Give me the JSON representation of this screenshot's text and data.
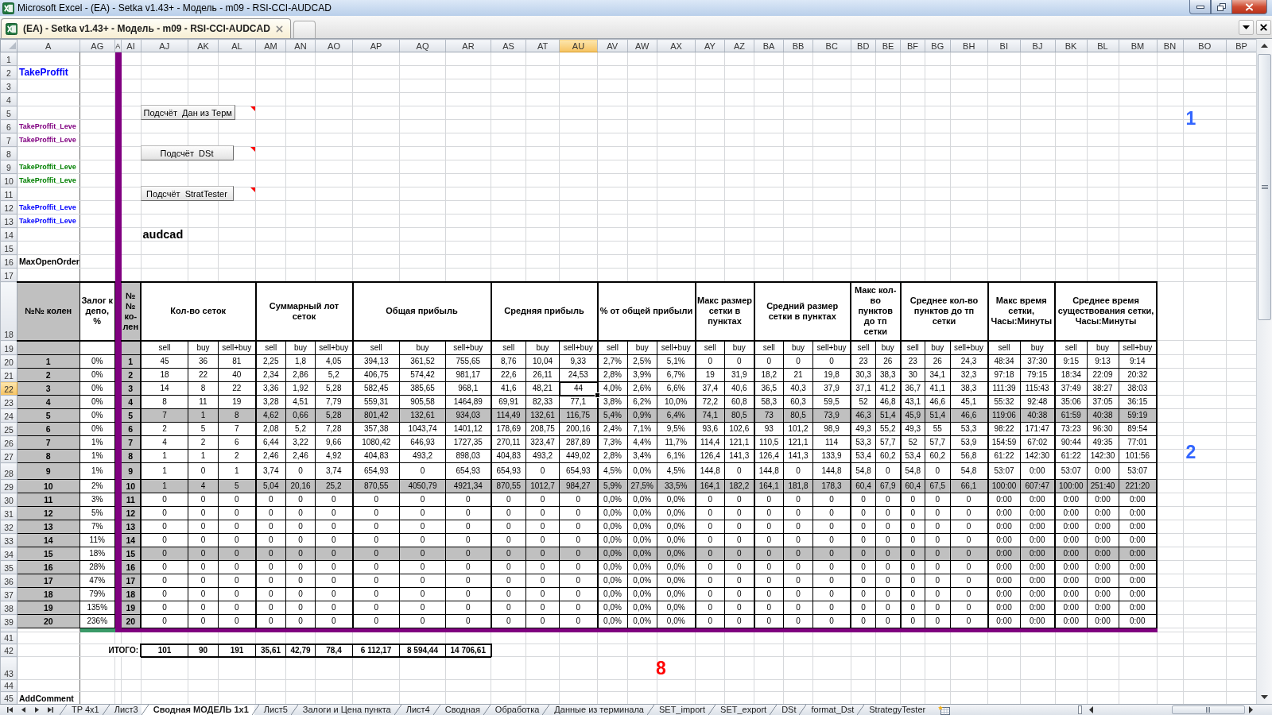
{
  "window": {
    "title": "Microsoft Excel - (EA) - Setka v1.43+ - Модель - m09 - RSI-CCI-AUDCAD"
  },
  "document_tabs": [
    {
      "label": "(EA) - Setka v1.43+ - Модель - m09 - RSI-CCI-AUDCAD",
      "selected": true
    }
  ],
  "columns": [
    {
      "label": "A",
      "selected": false
    },
    {
      "label": "AG",
      "selected": false
    },
    {
      "label": "A",
      "selected": false
    },
    {
      "label": "AI",
      "selected": false
    },
    {
      "label": "AJ",
      "selected": false
    },
    {
      "label": "AK",
      "selected": false
    },
    {
      "label": "AL",
      "selected": false
    },
    {
      "label": "AM",
      "selected": false
    },
    {
      "label": "AN",
      "selected": false
    },
    {
      "label": "AO",
      "selected": false
    },
    {
      "label": "AP",
      "selected": false
    },
    {
      "label": "AQ",
      "selected": false
    },
    {
      "label": "AR",
      "selected": false
    },
    {
      "label": "AS",
      "selected": false
    },
    {
      "label": "AT",
      "selected": false
    },
    {
      "label": "AU",
      "selected": true
    },
    {
      "label": "AV",
      "selected": false
    },
    {
      "label": "AW",
      "selected": false
    },
    {
      "label": "AX",
      "selected": false
    },
    {
      "label": "AY",
      "selected": false
    },
    {
      "label": "AZ",
      "selected": false
    },
    {
      "label": "BA",
      "selected": false
    },
    {
      "label": "BB",
      "selected": false
    },
    {
      "label": "BC",
      "selected": false
    },
    {
      "label": "BD",
      "selected": false
    },
    {
      "label": "BE",
      "selected": false
    },
    {
      "label": "BF",
      "selected": false
    },
    {
      "label": "BG",
      "selected": false
    },
    {
      "label": "BH",
      "selected": false
    },
    {
      "label": "BI",
      "selected": false
    },
    {
      "label": "BJ",
      "selected": false
    },
    {
      "label": "BK",
      "selected": false
    },
    {
      "label": "BL",
      "selected": false
    },
    {
      "label": "BM",
      "selected": false
    },
    {
      "label": "BN",
      "selected": false
    },
    {
      "label": "BO",
      "selected": false
    },
    {
      "label": "BP",
      "selected": false
    }
  ],
  "rows_above": [
    {
      "number": "1",
      "selected": false
    },
    {
      "number": "2",
      "selected": false,
      "label": {
        "text": "TakeProffit",
        "kind": "title",
        "color": "#0000ff"
      }
    },
    {
      "number": "3",
      "selected": false
    },
    {
      "number": "4",
      "selected": false
    },
    {
      "number": "5",
      "selected": false,
      "button": {
        "label": "Подсчёт  Дан из Терм",
        "comment_marker": true
      },
      "marker": {
        "text": "1",
        "color": "#3366ff"
      }
    },
    {
      "number": "6",
      "selected": false,
      "label": {
        "text": "TakeProffit_Leve",
        "kind": "level",
        "color": "#800080"
      }
    },
    {
      "number": "7",
      "selected": false,
      "label": {
        "text": "TakeProffit_Leve",
        "kind": "level",
        "color": "#800080"
      }
    },
    {
      "number": "8",
      "selected": false,
      "button": {
        "label": "Подсчёт  DSt",
        "comment_marker": true
      }
    },
    {
      "number": "9",
      "selected": false,
      "label": {
        "text": "TakeProffit_Leve",
        "kind": "level",
        "color": "#008000"
      }
    },
    {
      "number": "10",
      "selected": false,
      "label": {
        "text": "TakeProffit_Leve",
        "kind": "level",
        "color": "#008000"
      }
    },
    {
      "number": "11",
      "selected": false,
      "button": {
        "label": "Подсчёт  StratTester",
        "comment_marker": true
      }
    },
    {
      "number": "12",
      "selected": false,
      "label": {
        "text": "TakeProffit_Leve",
        "kind": "level",
        "color": "#0000ff"
      }
    },
    {
      "number": "13",
      "selected": false,
      "label": {
        "text": "TakeProffit_Leve",
        "kind": "level",
        "color": "#0000ff"
      }
    },
    {
      "number": "14",
      "selected": false,
      "symbol": "audcad"
    },
    {
      "number": "15",
      "selected": false
    },
    {
      "number": "16",
      "selected": false,
      "label": {
        "text": "MaxOpenOrder",
        "kind": "param",
        "color": "#000000"
      }
    },
    {
      "number": "17",
      "selected": false
    }
  ],
  "table": {
    "header_row": {
      "number": "18",
      "selected": false
    },
    "subheader_row": {
      "number": "19",
      "selected": false
    },
    "key_title": "№№ колен",
    "deposit_title": "Залог к депо, %",
    "index_title": "№ № ко-лен",
    "groups": [
      {
        "title": "Кол-во сеток",
        "columns": [
          "sell",
          "buy",
          "sell+buy"
        ]
      },
      {
        "title": "Суммарный лот сеток",
        "columns": [
          "sell",
          "buy",
          "sell+buy"
        ]
      },
      {
        "title": "Общая прибыль",
        "columns": [
          "sell",
          "buy",
          "sell+buy"
        ]
      },
      {
        "title": "Средняя прибыль",
        "columns": [
          "sell",
          "buy",
          "sell+buy"
        ]
      },
      {
        "title": "% от общей прибыли",
        "columns": [
          "sell",
          "buy",
          "sell+buy"
        ]
      },
      {
        "title": "Макс размер сетки в пунктах",
        "columns": [
          "sell",
          "buy"
        ]
      },
      {
        "title": "Средний размер сетки в пунктах",
        "columns": [
          "sell",
          "buy",
          "sell+buy"
        ]
      },
      {
        "title": "Макс кол-во пунктов до тп сетки",
        "columns": [
          "sell",
          "buy"
        ]
      },
      {
        "title": "Среднее кол-во пунктов до тп сетки",
        "columns": [
          "sell",
          "buy",
          "sell+buy"
        ]
      },
      {
        "title": "Макс время сетки, Часы:Минуты",
        "columns": [
          "sell",
          "buy"
        ]
      },
      {
        "title": "Среднее время существования сетки, Часы:Минуты",
        "columns": [
          "sell",
          "buy",
          "sell+buy"
        ]
      }
    ],
    "rows": [
      {
        "number": "20",
        "selected": false,
        "highlighted": false,
        "key": "1",
        "deposit": "0%",
        "index": "1",
        "values": [
          "45",
          "36",
          "81",
          "2,25",
          "1,8",
          "4,05",
          "394,13",
          "361,52",
          "755,65",
          "8,76",
          "10,04",
          "9,33",
          "2,7%",
          "2,5%",
          "5,1%",
          "0",
          "0",
          "0",
          "0",
          "0",
          "23",
          "26",
          "23",
          "26",
          "24,3",
          "48:34",
          "37:30",
          "9:15",
          "9:13",
          "9:14"
        ]
      },
      {
        "number": "21",
        "selected": false,
        "highlighted": false,
        "key": "2",
        "deposit": "0%",
        "index": "2",
        "values": [
          "18",
          "22",
          "40",
          "2,34",
          "2,86",
          "5,2",
          "406,75",
          "574,42",
          "981,17",
          "22,6",
          "26,11",
          "24,53",
          "2,8%",
          "3,9%",
          "6,7%",
          "19",
          "31,9",
          "18,2",
          "21",
          "19,8",
          "30,3",
          "38,3",
          "30",
          "34,1",
          "32,3",
          "97:18",
          "79:15",
          "18:34",
          "22:09",
          "20:32"
        ]
      },
      {
        "number": "22",
        "selected": true,
        "highlighted": false,
        "key": "3",
        "deposit": "0%",
        "index": "3",
        "values": [
          "14",
          "8",
          "22",
          "3,36",
          "1,92",
          "5,28",
          "582,45",
          "385,65",
          "968,1",
          "41,6",
          "48,21",
          "44",
          "4,0%",
          "2,6%",
          "6,6%",
          "37,4",
          "40,6",
          "36,5",
          "40,3",
          "37,9",
          "37,1",
          "41,2",
          "36,7",
          "41,1",
          "38,3",
          "111:39",
          "115:43",
          "37:49",
          "38:27",
          "38:03"
        ]
      },
      {
        "number": "23",
        "selected": false,
        "highlighted": false,
        "key": "4",
        "deposit": "0%",
        "index": "4",
        "values": [
          "8",
          "11",
          "19",
          "3,28",
          "4,51",
          "7,79",
          "559,31",
          "905,58",
          "1464,89",
          "69,91",
          "82,33",
          "77,1",
          "3,8%",
          "6,2%",
          "10,0%",
          "72,2",
          "60,8",
          "58,3",
          "60,3",
          "59,5",
          "52",
          "46,8",
          "43,1",
          "46,6",
          "45,1",
          "55:32",
          "92:48",
          "35:06",
          "37:05",
          "36:15"
        ]
      },
      {
        "number": "24",
        "selected": false,
        "highlighted": true,
        "key": "5",
        "deposit": "0%",
        "index": "5",
        "values": [
          "7",
          "1",
          "8",
          "4,62",
          "0,66",
          "5,28",
          "801,42",
          "132,61",
          "934,03",
          "114,49",
          "132,61",
          "116,75",
          "5,4%",
          "0,9%",
          "6,4%",
          "74,1",
          "80,5",
          "73",
          "80,5",
          "73,9",
          "46,3",
          "51,4",
          "45,9",
          "51,4",
          "46,6",
          "119:06",
          "40:38",
          "61:59",
          "40:38",
          "59:19"
        ]
      },
      {
        "number": "25",
        "selected": false,
        "highlighted": false,
        "key": "6",
        "deposit": "0%",
        "index": "6",
        "values": [
          "2",
          "5",
          "7",
          "2,08",
          "5,2",
          "7,28",
          "357,38",
          "1043,74",
          "1401,12",
          "178,69",
          "208,75",
          "200,16",
          "2,4%",
          "7,1%",
          "9,5%",
          "93,6",
          "102,6",
          "93",
          "101,2",
          "98,9",
          "49,3",
          "55,2",
          "49,3",
          "55",
          "53,3",
          "98:22",
          "171:47",
          "73:23",
          "96:30",
          "89:54"
        ]
      },
      {
        "number": "26",
        "selected": false,
        "highlighted": false,
        "key": "7",
        "deposit": "1%",
        "index": "7",
        "values": [
          "4",
          "2",
          "6",
          "6,44",
          "3,22",
          "9,66",
          "1080,42",
          "646,93",
          "1727,35",
          "270,11",
          "323,47",
          "287,89",
          "7,3%",
          "4,4%",
          "11,7%",
          "114,4",
          "121,1",
          "110,5",
          "121,1",
          "114",
          "53,3",
          "57,7",
          "52",
          "57,7",
          "53,9",
          "154:59",
          "67:02",
          "90:44",
          "49:35",
          "77:01"
        ],
        "marker": {
          "text": "2",
          "color": "#3366ff"
        }
      },
      {
        "number": "27",
        "selected": false,
        "highlighted": false,
        "key": "8",
        "deposit": "1%",
        "index": "8",
        "values": [
          "1",
          "1",
          "2",
          "2,46",
          "2,46",
          "4,92",
          "404,83",
          "493,2",
          "898,03",
          "404,83",
          "493,2",
          "449,02",
          "2,8%",
          "3,4%",
          "6,1%",
          "126,4",
          "141,3",
          "126,4",
          "141,3",
          "133,9",
          "53,4",
          "60,2",
          "53,4",
          "60,2",
          "56,8",
          "61:22",
          "142:30",
          "61:22",
          "142:30",
          "101:56"
        ]
      },
      {
        "number": "28",
        "selected": false,
        "highlighted": false,
        "key": "9",
        "deposit": "1%",
        "index": "9",
        "values": [
          "1",
          "0",
          "1",
          "3,74",
          "0",
          "3,74",
          "654,93",
          "0",
          "654,93",
          "654,93",
          "0",
          "654,93",
          "4,5%",
          "0,0%",
          "4,5%",
          "144,8",
          "0",
          "144,8",
          "0",
          "144,8",
          "54,8",
          "0",
          "54,8",
          "0",
          "54,8",
          "53:07",
          "0:00",
          "53:07",
          "0:00",
          "53:07"
        ]
      },
      {
        "number": "29",
        "selected": false,
        "highlighted": true,
        "key": "10",
        "deposit": "2%",
        "index": "10",
        "values": [
          "1",
          "4",
          "5",
          "5,04",
          "20,16",
          "25,2",
          "870,55",
          "4050,79",
          "4921,34",
          "870,55",
          "1012,7",
          "984,27",
          "5,9%",
          "27,5%",
          "33,5%",
          "164,1",
          "182,2",
          "164,1",
          "181,8",
          "178,3",
          "60,4",
          "67,9",
          "60,4",
          "67,5",
          "66,1",
          "100:00",
          "607:47",
          "100:00",
          "251:40",
          "221:20"
        ]
      },
      {
        "number": "30",
        "selected": false,
        "highlighted": false,
        "key": "11",
        "deposit": "3%",
        "index": "11",
        "values": [
          "0",
          "0",
          "0",
          "0",
          "0",
          "0",
          "0",
          "0",
          "0",
          "0",
          "0",
          "0",
          "0,0%",
          "0,0%",
          "0,0%",
          "0",
          "0",
          "0",
          "0",
          "0",
          "0",
          "0",
          "0",
          "0",
          "0",
          "0:00",
          "0:00",
          "0:00",
          "0:00",
          "0:00"
        ]
      },
      {
        "number": "31",
        "selected": false,
        "highlighted": false,
        "key": "12",
        "deposit": "5%",
        "index": "12",
        "values": [
          "0",
          "0",
          "0",
          "0",
          "0",
          "0",
          "0",
          "0",
          "0",
          "0",
          "0",
          "0",
          "0,0%",
          "0,0%",
          "0,0%",
          "0",
          "0",
          "0",
          "0",
          "0",
          "0",
          "0",
          "0",
          "0",
          "0",
          "0:00",
          "0:00",
          "0:00",
          "0:00",
          "0:00"
        ]
      },
      {
        "number": "32",
        "selected": false,
        "highlighted": false,
        "key": "13",
        "deposit": "7%",
        "index": "13",
        "values": [
          "0",
          "0",
          "0",
          "0",
          "0",
          "0",
          "0",
          "0",
          "0",
          "0",
          "0",
          "0",
          "0,0%",
          "0,0%",
          "0,0%",
          "0",
          "0",
          "0",
          "0",
          "0",
          "0",
          "0",
          "0",
          "0",
          "0",
          "0:00",
          "0:00",
          "0:00",
          "0:00",
          "0:00"
        ]
      },
      {
        "number": "33",
        "selected": false,
        "highlighted": false,
        "key": "14",
        "deposit": "11%",
        "index": "14",
        "values": [
          "0",
          "0",
          "0",
          "0",
          "0",
          "0",
          "0",
          "0",
          "0",
          "0",
          "0",
          "0",
          "0,0%",
          "0,0%",
          "0,0%",
          "0",
          "0",
          "0",
          "0",
          "0",
          "0",
          "0",
          "0",
          "0",
          "0",
          "0:00",
          "0:00",
          "0:00",
          "0:00",
          "0:00"
        ]
      },
      {
        "number": "34",
        "selected": false,
        "highlighted": true,
        "key": "15",
        "deposit": "18%",
        "index": "15",
        "values": [
          "0",
          "0",
          "0",
          "0",
          "0",
          "0",
          "0",
          "0",
          "0",
          "0",
          "0",
          "0",
          "0,0%",
          "0,0%",
          "0,0%",
          "0",
          "0",
          "0",
          "0",
          "0",
          "0",
          "0",
          "0",
          "0",
          "0",
          "0:00",
          "0:00",
          "0:00",
          "0:00",
          "0:00"
        ]
      },
      {
        "number": "35",
        "selected": false,
        "highlighted": false,
        "key": "16",
        "deposit": "28%",
        "index": "16",
        "values": [
          "0",
          "0",
          "0",
          "0",
          "0",
          "0",
          "0",
          "0",
          "0",
          "0",
          "0",
          "0",
          "0,0%",
          "0,0%",
          "0,0%",
          "0",
          "0",
          "0",
          "0",
          "0",
          "0",
          "0",
          "0",
          "0",
          "0",
          "0:00",
          "0:00",
          "0:00",
          "0:00",
          "0:00"
        ]
      },
      {
        "number": "36",
        "selected": false,
        "highlighted": false,
        "key": "17",
        "deposit": "47%",
        "index": "17",
        "values": [
          "0",
          "0",
          "0",
          "0",
          "0",
          "0",
          "0",
          "0",
          "0",
          "0",
          "0",
          "0",
          "0,0%",
          "0,0%",
          "0,0%",
          "0",
          "0",
          "0",
          "0",
          "0",
          "0",
          "0",
          "0",
          "0",
          "0",
          "0:00",
          "0:00",
          "0:00",
          "0:00",
          "0:00"
        ]
      },
      {
        "number": "37",
        "selected": false,
        "highlighted": false,
        "key": "18",
        "deposit": "79%",
        "index": "18",
        "values": [
          "0",
          "0",
          "0",
          "0",
          "0",
          "0",
          "0",
          "0",
          "0",
          "0",
          "0",
          "0",
          "0,0%",
          "0,0%",
          "0,0%",
          "0",
          "0",
          "0",
          "0",
          "0",
          "0",
          "0",
          "0",
          "0",
          "0",
          "0:00",
          "0:00",
          "0:00",
          "0:00",
          "0:00"
        ]
      },
      {
        "number": "38",
        "selected": false,
        "highlighted": false,
        "key": "19",
        "deposit": "135%",
        "index": "19",
        "values": [
          "0",
          "0",
          "0",
          "0",
          "0",
          "0",
          "0",
          "0",
          "0",
          "0",
          "0",
          "0",
          "0,0%",
          "0,0%",
          "0,0%",
          "0",
          "0",
          "0",
          "0",
          "0",
          "0",
          "0",
          "0",
          "0",
          "0",
          "0:00",
          "0:00",
          "0:00",
          "0:00",
          "0:00"
        ]
      },
      {
        "number": "39",
        "selected": false,
        "highlighted": false,
        "key": "20",
        "deposit": "236%",
        "index": "20",
        "values": [
          "0",
          "0",
          "0",
          "0",
          "0",
          "0",
          "0",
          "0",
          "0",
          "0",
          "0",
          "0",
          "0,0%",
          "0,0%",
          "0,0%",
          "0",
          "0",
          "0",
          "0",
          "0",
          "0",
          "0",
          "0",
          "0",
          "0",
          "0:00",
          "0:00",
          "0:00",
          "0:00",
          "0:00"
        ]
      }
    ]
  },
  "rows_below": [
    {
      "number": "41",
      "selected": false
    },
    {
      "number": "42",
      "selected": false,
      "totals_label": "ИТОГО:",
      "totals": [
        "101",
        "90",
        "191",
        "35,61",
        "42,79",
        "78,4",
        "6 112,17",
        "8 594,44",
        "14 706,61"
      ]
    },
    {
      "number": "43",
      "selected": false,
      "marker": {
        "text": "8",
        "color": "#ff0000"
      }
    },
    {
      "number": "44",
      "selected": false
    },
    {
      "number": "45",
      "selected": false,
      "label": {
        "text": "AddComment",
        "kind": "param",
        "color": "#000000"
      }
    }
  ],
  "sheet_tabs": [
    {
      "label": "TP 4x1",
      "selected": false
    },
    {
      "label": "Лист3",
      "selected": false
    },
    {
      "label": "Сводная МОДЕЛЬ 1x1",
      "selected": true
    },
    {
      "label": "Лист5",
      "selected": false
    },
    {
      "label": "Залоги и Цена пункта",
      "selected": false
    },
    {
      "label": "Лист4",
      "selected": false
    },
    {
      "label": "Сводная",
      "selected": false
    },
    {
      "label": "Обработка",
      "selected": false
    },
    {
      "label": "Данные из терминала",
      "selected": false
    },
    {
      "label": "SET_import",
      "selected": false
    },
    {
      "label": "SET_export",
      "selected": false
    },
    {
      "label": "DSt",
      "selected": false
    },
    {
      "label": "format_Dst",
      "selected": false
    },
    {
      "label": "StrategyTester",
      "selected": false
    }
  ]
}
